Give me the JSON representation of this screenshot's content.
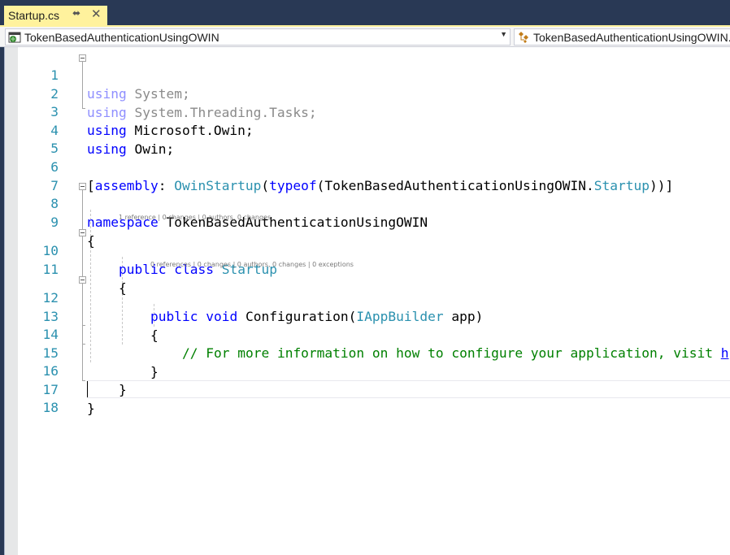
{
  "tab": {
    "title": "Startup.cs",
    "pin_icon": "pin-icon",
    "close_icon": "close-icon"
  },
  "navigation": {
    "project_dropdown": {
      "value": "TokenBasedAuthenticationUsingOWIN",
      "icon": "csharp-project-icon"
    },
    "type_dropdown": {
      "value": "TokenBasedAuthenticationUsingOWIN.Startup",
      "icon": "class-icon"
    }
  },
  "editor": {
    "line_numbers": [
      "1",
      "2",
      "3",
      "4",
      "5",
      "6",
      "7",
      "8",
      "9",
      "10",
      "11",
      "12",
      "13",
      "14",
      "15",
      "16",
      "17",
      "18"
    ],
    "code_lens": {
      "class": "1 reference | 0 changes | 0 authors, 0 changes",
      "method": "0 references | 0 changes | 0 authors, 0 changes | 0 exceptions"
    },
    "tokens": {
      "using": "using",
      "system": " System;",
      "system_threading": " System.Threading.Tasks;",
      "microsoft_owin": " Microsoft.Owin;",
      "owin": " Owin;",
      "bracket_open": "[",
      "assembly": "assembly",
      "colon": ": ",
      "owin_startup": "OwinStartup",
      "paren": "(",
      "typeof": "typeof",
      "ns_prefix": "(TokenBasedAuthenticationUsingOWIN.",
      "startup": "Startup",
      "attr_close": "))]",
      "namespace": "namespace",
      "namespace_name": " TokenBasedAuthenticationUsingOWIN",
      "brace_open": "{",
      "brace_close": "}",
      "public": "public",
      "class": "class",
      "void": "void",
      "configuration": " Configuration(",
      "iappbuilder": "IAppBuilder",
      "app": " app)",
      "comment": "// For more information on how to configure your application, visit ",
      "link_start": "h"
    }
  }
}
